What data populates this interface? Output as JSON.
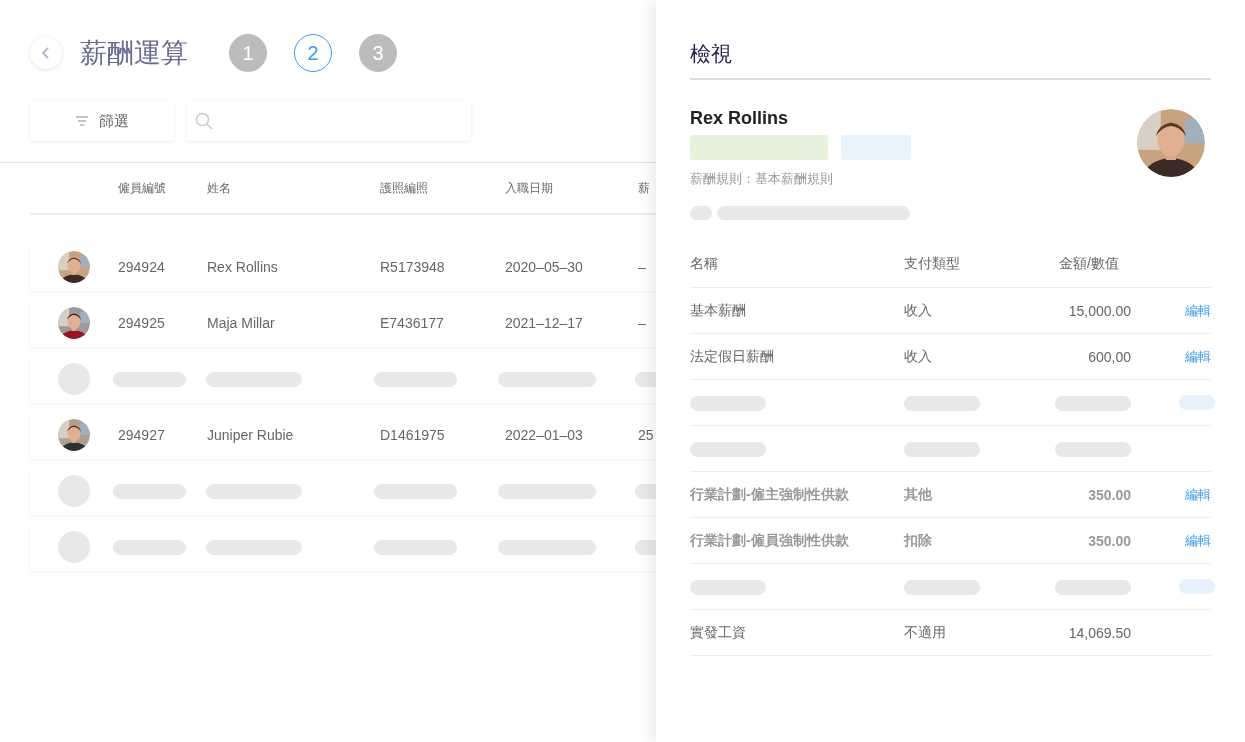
{
  "page": {
    "title": "薪酬運算"
  },
  "steps": [
    {
      "label": "1",
      "selected": false
    },
    {
      "label": "2",
      "selected": true
    },
    {
      "label": "3",
      "selected": false
    }
  ],
  "toolbar": {
    "filter_label": "篩選"
  },
  "table": {
    "columns": [
      "僱員編號",
      "姓名",
      "護照編照",
      "入職日期",
      "薪"
    ],
    "rows": [
      {
        "kind": "employee",
        "id": "294924",
        "name": "Rex Rollins",
        "passport": "R5173948",
        "join_date": "2020–05–30",
        "column_5": "–"
      },
      {
        "kind": "employee",
        "id": "294925",
        "name": "Maja Millar",
        "passport": "E7436177",
        "join_date": "2021–12–17",
        "column_5": "–"
      },
      {
        "kind": "placeholder"
      },
      {
        "kind": "employee",
        "id": "294927",
        "name": "Juniper Rubie",
        "passport": "D1461975",
        "join_date": "2022–01–03",
        "column_5": "25"
      },
      {
        "kind": "placeholder"
      },
      {
        "kind": "placeholder"
      }
    ]
  },
  "panel": {
    "title": "檢視",
    "name": "Rex Rollins",
    "rule": "薪酬規則：基本薪酬規則",
    "columns": [
      "名稱",
      "支付類型",
      "金額/數值"
    ],
    "items": [
      {
        "kind": "item",
        "name": "基本薪酬",
        "type": "收入",
        "amount": "15,000.00",
        "action": "編輯"
      },
      {
        "kind": "item",
        "name": "法定假日薪酬",
        "type": "收入",
        "amount": "600,00",
        "action": "編輯"
      },
      {
        "kind": "placeholder",
        "has_action": true
      },
      {
        "kind": "placeholder",
        "has_action": false
      },
      {
        "kind": "bold-item",
        "name": "行業計劃-僱主強制性供款",
        "type": "其他",
        "amount": "350.00",
        "action": "編輯"
      },
      {
        "kind": "bold-item",
        "name": "行業計劃-僱員強制性供款",
        "type": "扣除",
        "amount": "350.00",
        "action": "編輯"
      },
      {
        "kind": "placeholder",
        "has_action": true
      },
      {
        "kind": "item",
        "name": "實發工資",
        "type": "不適用",
        "amount": "14,069.50"
      }
    ]
  }
}
